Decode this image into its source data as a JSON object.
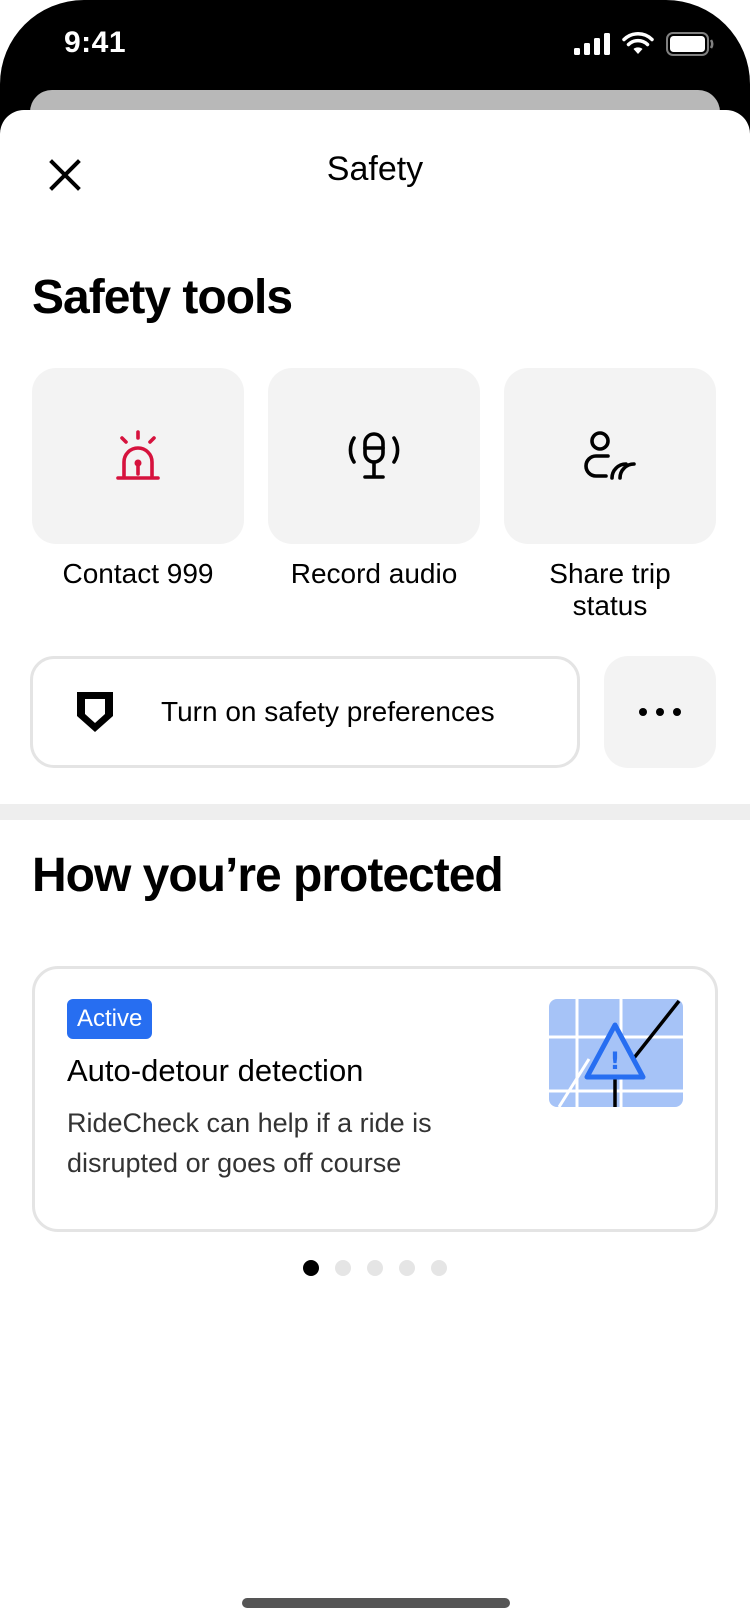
{
  "status_bar": {
    "time": "9:41"
  },
  "nav": {
    "title": "Safety",
    "close_icon": "close-icon"
  },
  "safety_tools": {
    "heading": "Safety tools",
    "tools": [
      {
        "label": "Contact 999",
        "icon": "siren-icon",
        "icon_color": "#d6123d"
      },
      {
        "label": "Record audio",
        "icon": "microphone-icon",
        "icon_color": "#000000"
      },
      {
        "label": "Share trip status",
        "icon": "share-trip-icon",
        "icon_color": "#000000"
      }
    ],
    "preferences_button": {
      "label": "Turn on safety preferences",
      "icon": "shield-icon"
    },
    "more_button": {
      "icon": "more-icon"
    }
  },
  "protection": {
    "heading": "How you’re protected",
    "card": {
      "badge": "Active",
      "badge_color": "#276ef1",
      "title": "Auto-detour detection",
      "description": "RideCheck can help if a ride is disrupted or goes off course",
      "illustration": "map-warning-icon"
    },
    "pager": {
      "count": 5,
      "active_index": 0
    }
  }
}
